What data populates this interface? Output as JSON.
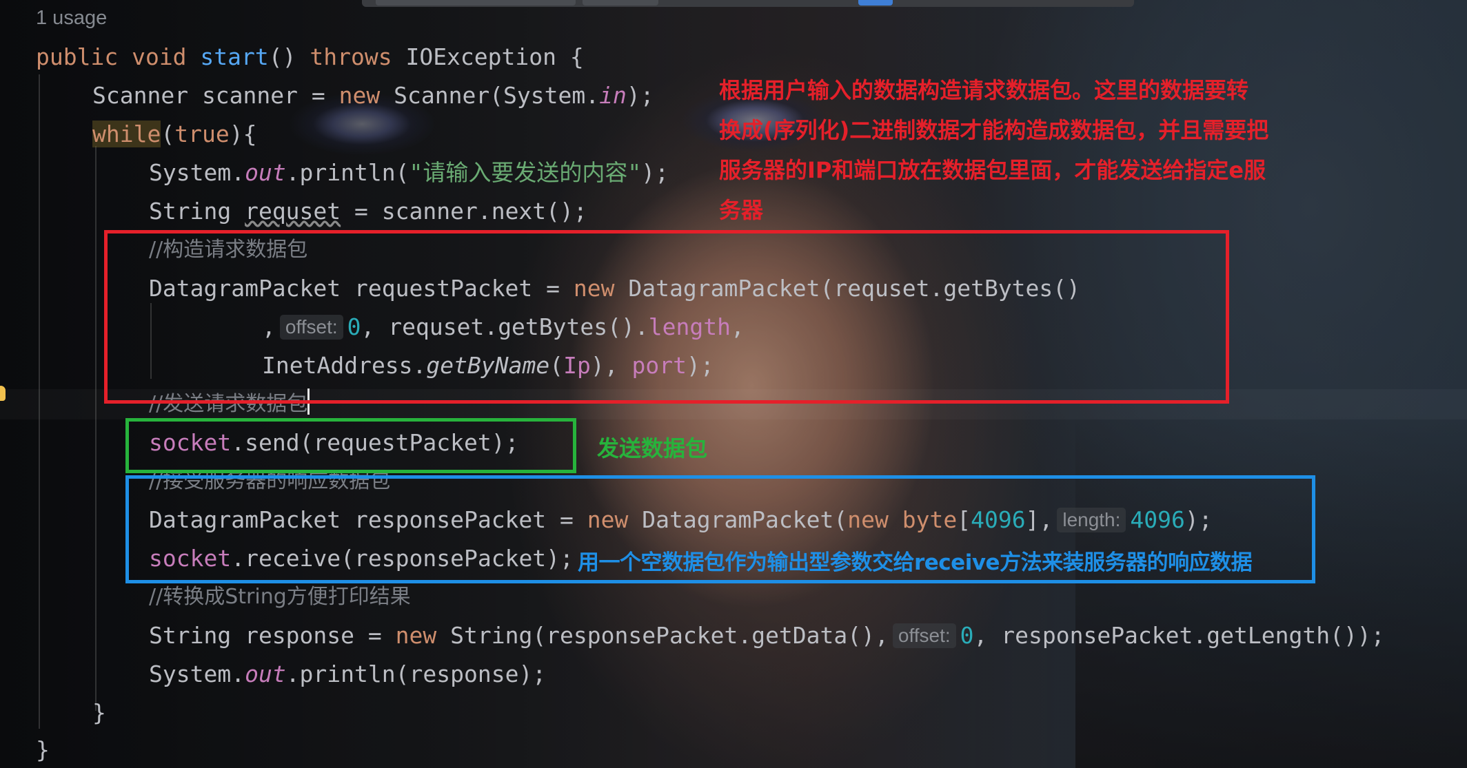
{
  "editor": {
    "usage_hint": "1 usage",
    "lines": {
      "l1": {
        "public": "public ",
        "void": "void ",
        "name": "start",
        "sig": "() ",
        "throws": "throws ",
        "exc": "IOException {"
      },
      "l2": {
        "type": "Scanner scanner = ",
        "new": "new ",
        "ctor": "Scanner(System.",
        "in": "in",
        "end": ");"
      },
      "l3": {
        "while": "while",
        "open": "(",
        "true": "true",
        "close": "){"
      },
      "l4": {
        "a": "System.",
        "out": "out",
        "b": ".println(",
        "str": "\"请输入要发送的内容\"",
        "c": ");"
      },
      "l5": {
        "a": "String ",
        "var": "requset",
        "b": " = scanner.next();"
      },
      "l6": {
        "comment": "//构造请求数据包"
      },
      "l7": {
        "a": "DatagramPacket requestPacket = ",
        "new": "new ",
        "b": "DatagramPacket(requset.getBytes()"
      },
      "l8": {
        "comma": ",",
        "hint": "offset:",
        "zero": "0",
        "b": ", requset.getBytes().",
        "len": "length",
        "c": ","
      },
      "l9": {
        "a": "InetAddress.",
        "m": "getByName",
        "b": "(",
        "ip": "Ip",
        "c": "), ",
        "port": "port",
        "d": ");"
      },
      "l10": {
        "comment": "//发送请求数据包"
      },
      "l11": {
        "socket": "socket",
        "b": ".send(requestPacket);"
      },
      "l12": {
        "comment": "//接受服务器的响应数据包"
      },
      "l13": {
        "a": "DatagramPacket responsePacket = ",
        "new1": "new ",
        "b": "DatagramPacket(",
        "new2": "new ",
        "byte": "byte",
        "c": "[",
        "n1": "4096",
        "d": "],",
        "hint": "length:",
        "n2": "4096",
        "e": ");"
      },
      "l14": {
        "socket": "socket",
        "b": ".receive(responsePacket);"
      },
      "l15": {
        "comment": "//转换成String方便打印结果"
      },
      "l16": {
        "a": "String response = ",
        "new": "new ",
        "b": "String(responsePacket.getData(),",
        "hint": "offset:",
        "zero": "0",
        "c": ", responsePacket.getLength());"
      },
      "l17": {
        "a": "System.",
        "out": "out",
        "b": ".println(response);"
      },
      "l18": {
        "brace": "}"
      },
      "l19": {
        "brace": "}"
      }
    }
  },
  "annotations": {
    "red_note": [
      "根据用户输入的数据构造请求数据包。这里的数据要转",
      "换成(序列化)二进制数据才能构造成数据包，并且需要把",
      "服务器的IP和端口放在数据包里面，才能发送给指定e服",
      "务器"
    ],
    "green_note": "发送数据包",
    "blue_note": "用一个空数据包作为输出型参数交给receive方法来装服务器的响应数据",
    "colors": {
      "red": "#e5202a",
      "green": "#27b33c",
      "blue": "#1e8fe6"
    }
  }
}
